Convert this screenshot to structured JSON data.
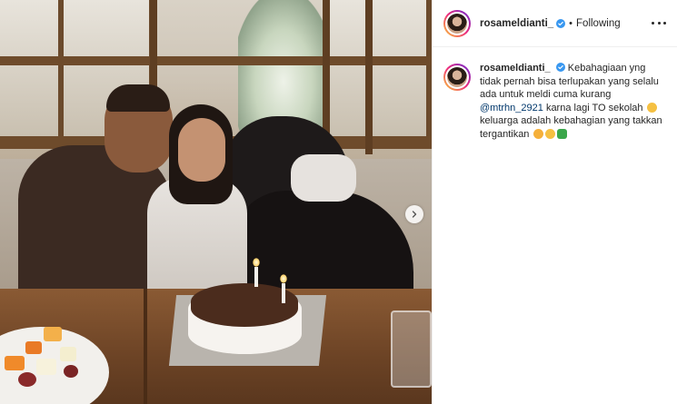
{
  "post": {
    "username": "rosameldianti_",
    "follow_status": "Following",
    "separator": "•",
    "caption": {
      "username": "rosameldianti_",
      "text_before_mention": "Kebahagiaan yng tidak pernah bisa terlupakan yang selalu ada untuk meldi cuma kurang",
      "mention": "@mtrhn_2921",
      "text_after_mention": "karna lagi TO sekolah",
      "text_line_end": "keluarga adalah kebahagian yang takkan tergantikan"
    }
  },
  "icons": {
    "verified": "verified-badge-icon",
    "more": "more-options-icon",
    "next": "chevron-right-icon"
  },
  "colors": {
    "verified_blue": "#3897f0",
    "mention_blue": "#00376b",
    "text": "#262626"
  }
}
